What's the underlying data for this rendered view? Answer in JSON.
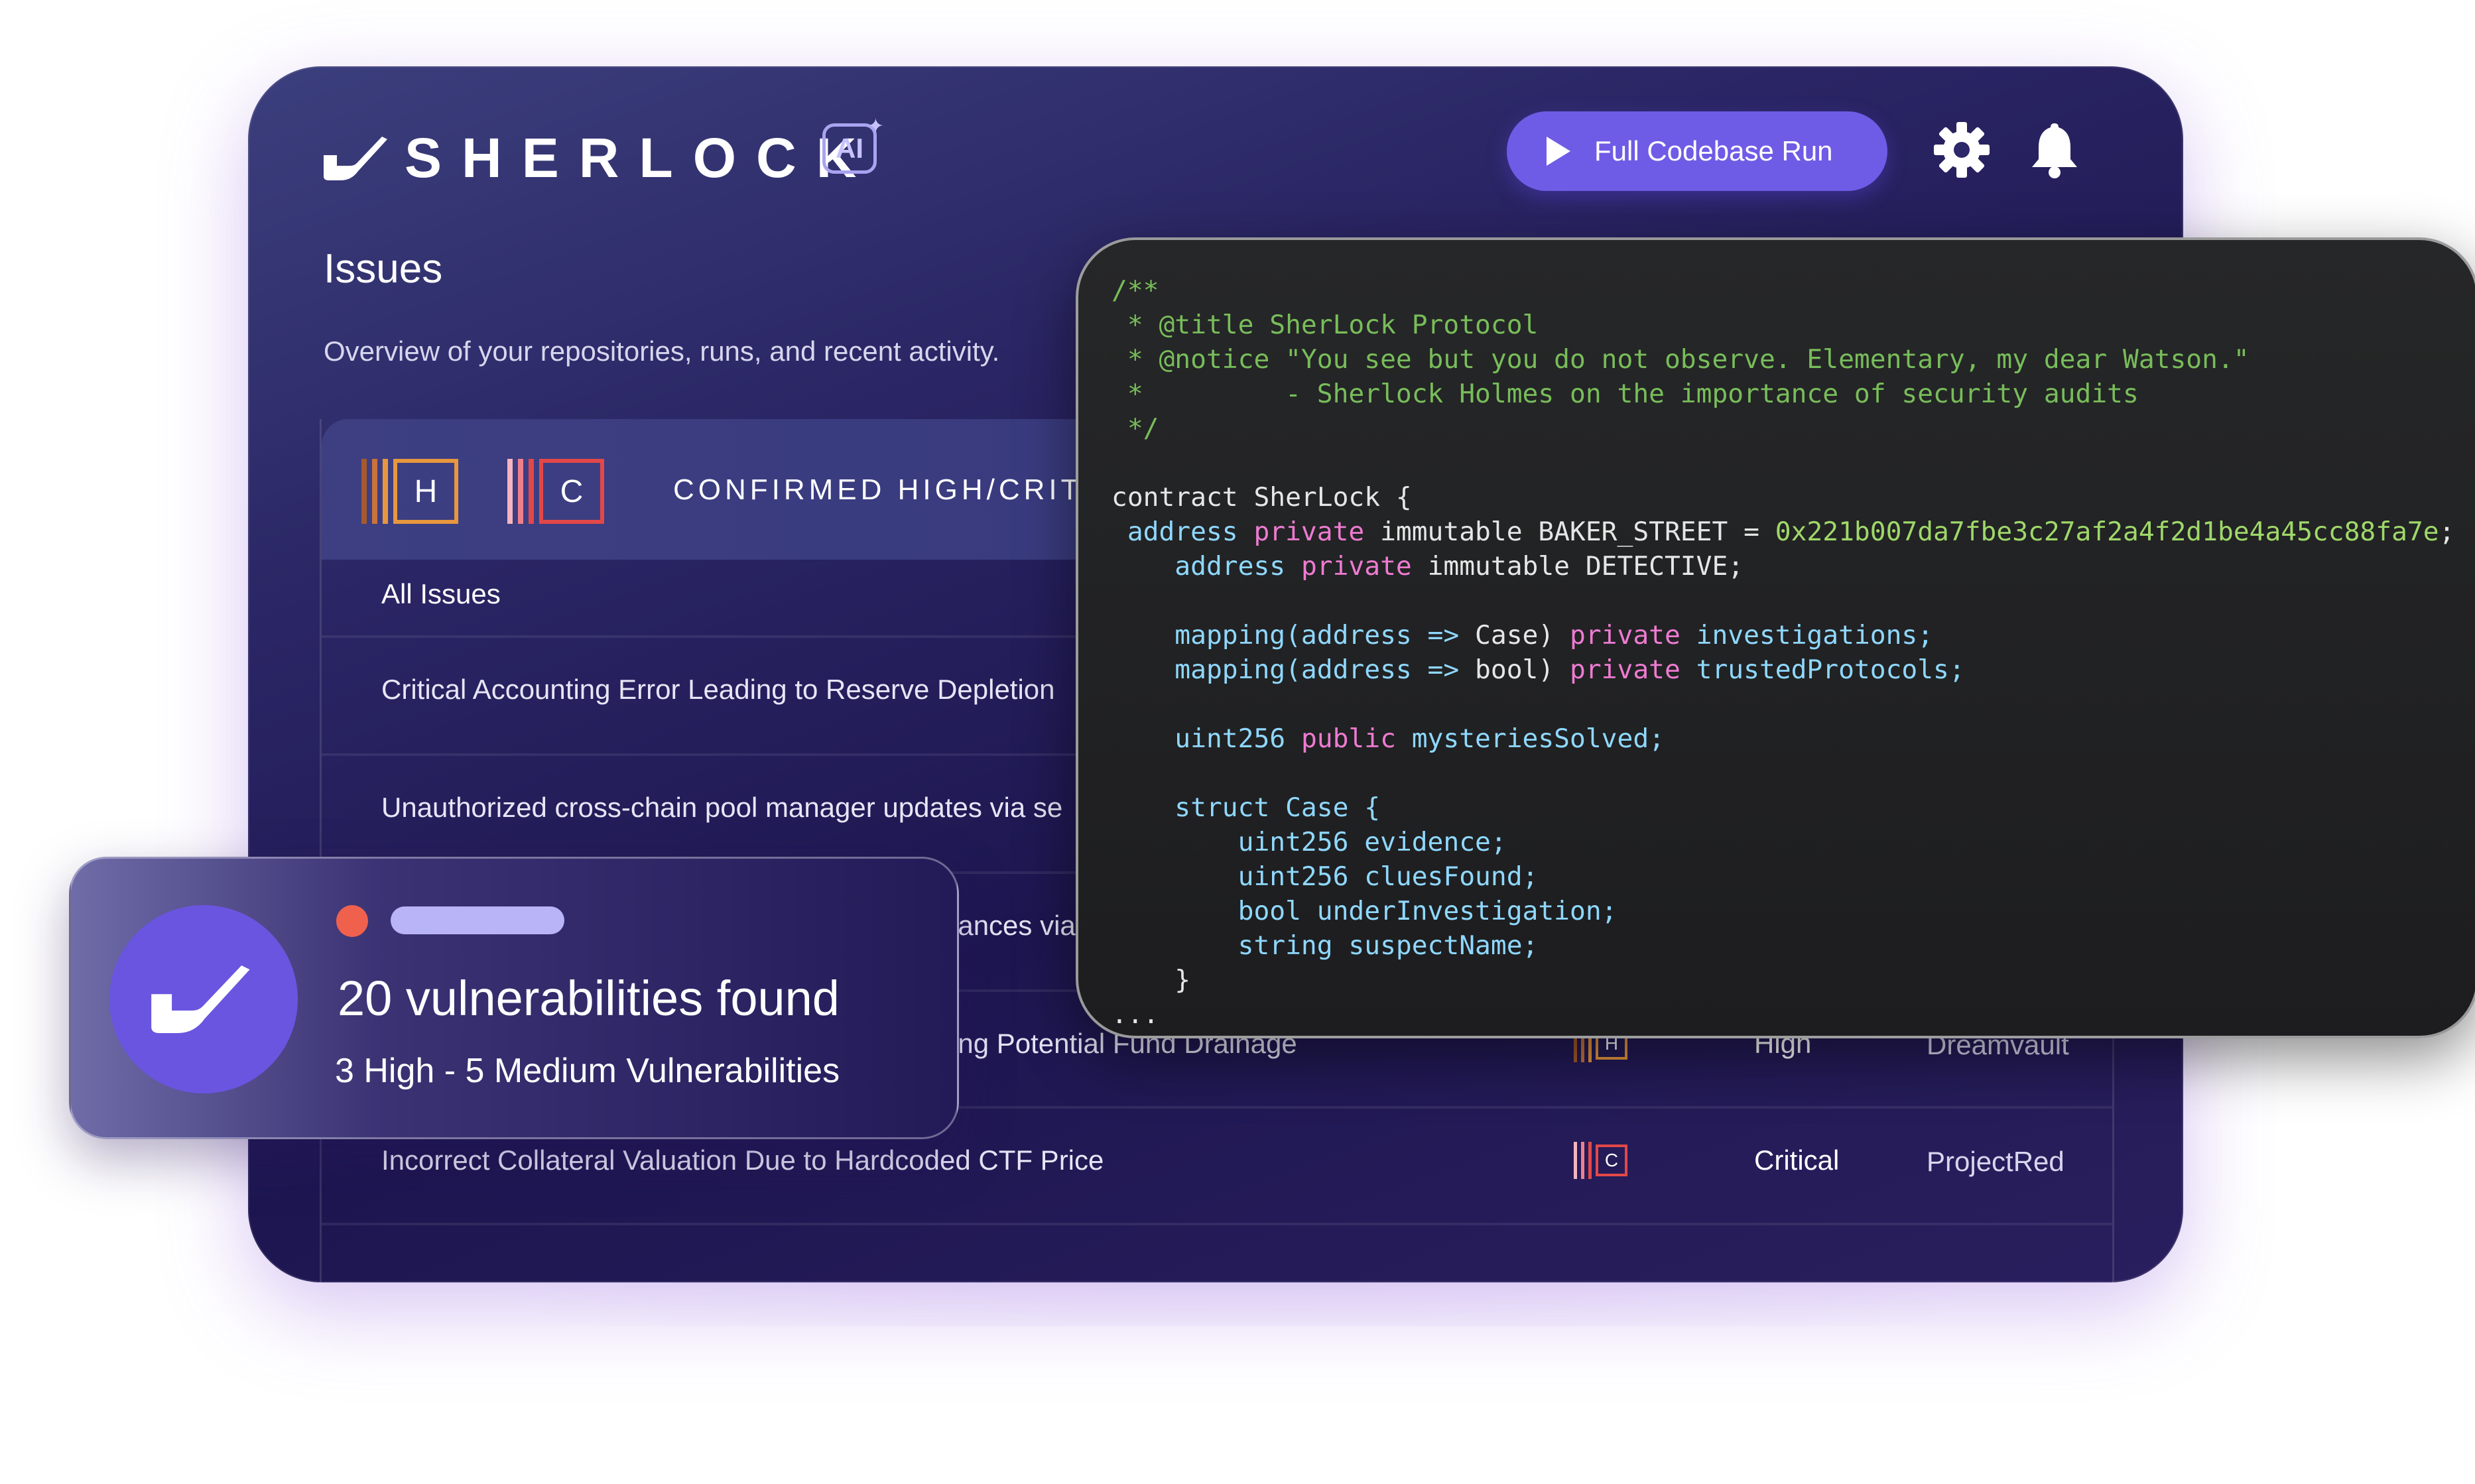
{
  "app": {
    "brand": "SHERLOCK",
    "ai_badge": "AI",
    "run_button": "Full Codebase Run",
    "icons": [
      "sherlock-pipe-icon",
      "play-icon",
      "gear-icon",
      "bell-icon",
      "sparkle-icon"
    ]
  },
  "page": {
    "title": "Issues",
    "subtitle": "Overview of your repositories, runs, and recent activity."
  },
  "table": {
    "header_label": "CONFIRMED HIGH/CRITICAL",
    "header_badges": [
      "H",
      "C"
    ],
    "tab": "All Issues",
    "rows": [
      {
        "title": "Critical Accounting Error Leading to Reserve Depletion"
      },
      {
        "title": "Unauthorized cross-chain pool manager updates via se"
      },
      {
        "title": "lances via"
      },
      {
        "title": "ing Potential Fund Drainage",
        "badge": "H",
        "severity": "High",
        "project": "Dreamvault"
      },
      {
        "title": "Incorrect Collateral Valuation Due to Hardcoded CTF Price",
        "badge": "C",
        "severity": "Critical",
        "project": "ProjectRed"
      }
    ]
  },
  "code": {
    "lines": [
      [
        {
          "t": "/**",
          "c": "com"
        }
      ],
      [
        {
          "t": " * @title SherLock Protocol",
          "c": "com"
        }
      ],
      [
        {
          "t": " * @notice \"You see but you do not observe. Elementary, my dear Watson.\"",
          "c": "com"
        }
      ],
      [
        {
          "t": " *         - Sherlock Holmes on the importance of security audits",
          "c": "com"
        }
      ],
      [
        {
          "t": " */",
          "c": "com"
        }
      ],
      [
        {
          "t": "",
          "c": "plain"
        }
      ],
      [
        {
          "t": "contract SherLock {",
          "c": "plain"
        }
      ],
      [
        {
          "t": " address ",
          "c": "type"
        },
        {
          "t": "private ",
          "c": "kw"
        },
        {
          "t": "immutable BAKER_STREET = ",
          "c": "plain"
        },
        {
          "t": "0x221b007da7fbe3c27af2a4f2d1be4a45cc88fa7e",
          "c": "hex"
        },
        {
          "t": ";",
          "c": "plain"
        }
      ],
      [
        {
          "t": "    address ",
          "c": "type"
        },
        {
          "t": "private ",
          "c": "kw"
        },
        {
          "t": "immutable DETECTIVE;",
          "c": "plain"
        }
      ],
      [
        {
          "t": "",
          "c": "plain"
        }
      ],
      [
        {
          "t": "    mapping(address => ",
          "c": "type"
        },
        {
          "t": "Case) ",
          "c": "plain"
        },
        {
          "t": "private ",
          "c": "kw"
        },
        {
          "t": "investigations;",
          "c": "type"
        }
      ],
      [
        {
          "t": "    mapping(address => ",
          "c": "type"
        },
        {
          "t": "bool) ",
          "c": "plain"
        },
        {
          "t": "private ",
          "c": "kw"
        },
        {
          "t": "trustedProtocols;",
          "c": "type"
        }
      ],
      [
        {
          "t": "",
          "c": "plain"
        }
      ],
      [
        {
          "t": "    uint256 ",
          "c": "type"
        },
        {
          "t": "public ",
          "c": "kw"
        },
        {
          "t": "mysteriesSolved;",
          "c": "type"
        }
      ],
      [
        {
          "t": "",
          "c": "plain"
        }
      ],
      [
        {
          "t": "    struct Case {",
          "c": "type"
        }
      ],
      [
        {
          "t": "        uint256 evidence;",
          "c": "type"
        }
      ],
      [
        {
          "t": "        uint256 cluesFound;",
          "c": "type"
        }
      ],
      [
        {
          "t": "        bool underInvestigation;",
          "c": "type"
        }
      ],
      [
        {
          "t": "        string suspectName;",
          "c": "type"
        }
      ],
      [
        {
          "t": "    }",
          "c": "plain"
        }
      ],
      [
        {
          "t": "...",
          "c": "plain"
        }
      ]
    ]
  },
  "card": {
    "title": "20 vulnerabilities found",
    "subtitle": "3 High - 5 Medium Vulnerabilities"
  },
  "colors": {
    "accent": "#6e5ce6",
    "high": "#e8973e",
    "critical": "#e34848",
    "code_comment": "#78bd5a",
    "code_keyword": "#ee7bd2",
    "code_type": "#8fd8ff"
  }
}
